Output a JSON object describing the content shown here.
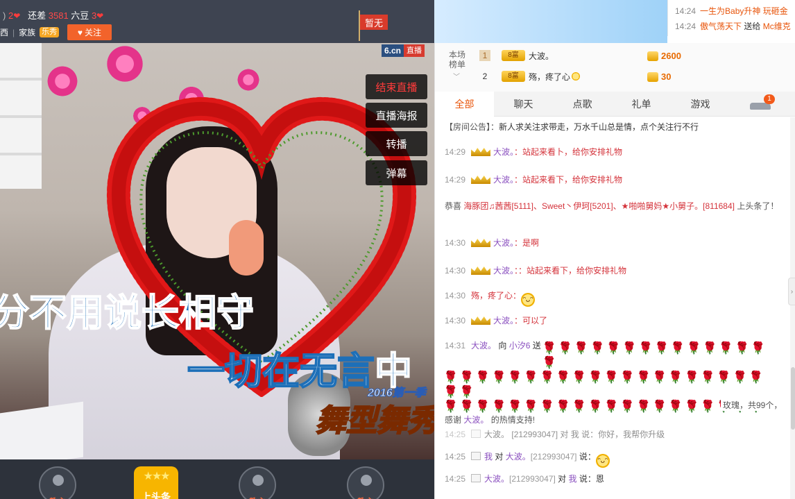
{
  "header": {
    "count_a": "2",
    "gap_label": "还差",
    "gap_value": "3581",
    "currency": "六豆",
    "count_b": "3",
    "left_fragment": "西",
    "family_label": "家族",
    "family_badge": "乐秀",
    "follow_label": "关注",
    "flag_label": "暂无"
  },
  "video": {
    "brand": "6.cn",
    "live_badge": "直播",
    "buttons": [
      "结束直播",
      "直播海报",
      "转播",
      "弹幕"
    ],
    "lyric_line1": "分不用说长相守",
    "lyric_line2_a": "一切在无言",
    "lyric_line2_b": "中",
    "show_season": "2016第一季",
    "show_title": "舞型舞秀"
  },
  "dock": {
    "items": [
      "教主",
      "上头条",
      "教主",
      "教主"
    ]
  },
  "ticker": {
    "rows": [
      {
        "time": "14:24",
        "text": "一生为Baby升神 玩砸金"
      },
      {
        "time": "14:24",
        "text": "傲气荡天下",
        "text2": " 送给 ",
        "text3": "Mc维克"
      }
    ]
  },
  "rank": {
    "title": "本场榜单",
    "rows": [
      {
        "num": "1",
        "badge": "8富",
        "name": "大波。",
        "score": "2600"
      },
      {
        "num": "2",
        "badge": "8富",
        "name": "殇，疼了心",
        "score": "30"
      }
    ]
  },
  "tabs": [
    "全部",
    "聊天",
    "点歌",
    "礼单",
    "游戏"
  ],
  "car_count": "1",
  "chat": {
    "notice_label": "【房间公告】：",
    "notice_text": "新人求关注求带走，万水千山总是情，点个关注行不行",
    "messages": [
      {
        "time": "14:29",
        "name": "大波。",
        "text": "：站起来看卜，给你安排礼物"
      },
      {
        "time": "14:29",
        "name": "大波。",
        "text": "：站起来看下，给你安排礼物"
      },
      {
        "time": "14:30",
        "name": "大波。",
        "text": "：是啊"
      },
      {
        "time": "14:30",
        "name": "大波。",
        "text": "：：站起来看下，给你安排礼物"
      },
      {
        "time": "14:30",
        "name": "殇，疼了心",
        "text": "："
      },
      {
        "time": "14:30",
        "name": "大波。",
        "text": "：可以了"
      }
    ],
    "congrats_prefix": "恭喜",
    "congrats_names": "海豚团♫茜茜[5111]、Sweet丶伊珂[5201]、★啪啪舅妈★小舅子。[811684]",
    "congrats_suffix": "上头条了！",
    "gift_time": "14:31",
    "gift_from": "大波。",
    "gift_to_label": "向",
    "gift_to": "小汐6",
    "gift_send": "送",
    "gift_tail": "玫瑰，共99个，",
    "thanks_prefix": "感谢",
    "thanks_name": "大波。",
    "thanks_suffix": "的热情支持!",
    "partial_row": {
      "time": "14:25",
      "text": "大波。 [212993047] 对 我 说：你好，我帮你升级"
    },
    "row_a": {
      "time": "14:25",
      "me": "我",
      "to": "对",
      "name": "大波。",
      "id": "[212993047]",
      "said": "说："
    },
    "row_b": {
      "time": "14:25",
      "name": "大波。",
      "id": "[212993047]",
      "to": "对",
      "me": "我",
      "said": "说：恩"
    }
  },
  "colors": {
    "accent": "#e8540a",
    "header_bg": "#3e4451",
    "follow_btn": "#f2632b",
    "name_purple": "#8a4fbf",
    "text_red": "#d4333b"
  }
}
